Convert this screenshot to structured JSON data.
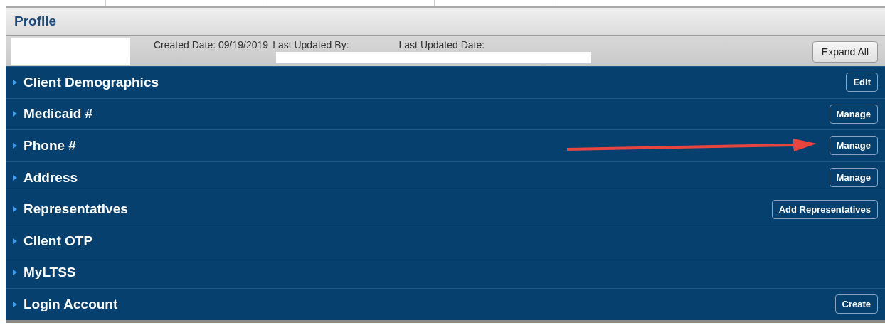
{
  "header": {
    "title": "Profile"
  },
  "info": {
    "created": "Created Date: 09/19/2019",
    "updated_by": "Last Updated By:",
    "updated_date": "Last Updated Date:"
  },
  "expand_button": "Expand All",
  "sections": [
    {
      "title": "Client Demographics",
      "button": "Edit",
      "marked": false
    },
    {
      "title": "Medicaid #",
      "button": "Manage",
      "marked": false
    },
    {
      "title": "Phone #",
      "button": "Manage",
      "marked": true
    },
    {
      "title": "Address",
      "button": "Manage",
      "marked": false
    },
    {
      "title": "Representatives",
      "button": "Add Representatives",
      "marked": false
    },
    {
      "title": "Client OTP",
      "marked": false
    },
    {
      "title": "MyLTSS",
      "marked": false
    },
    {
      "title": "Login Account",
      "button": "Create",
      "marked": false
    }
  ]
}
